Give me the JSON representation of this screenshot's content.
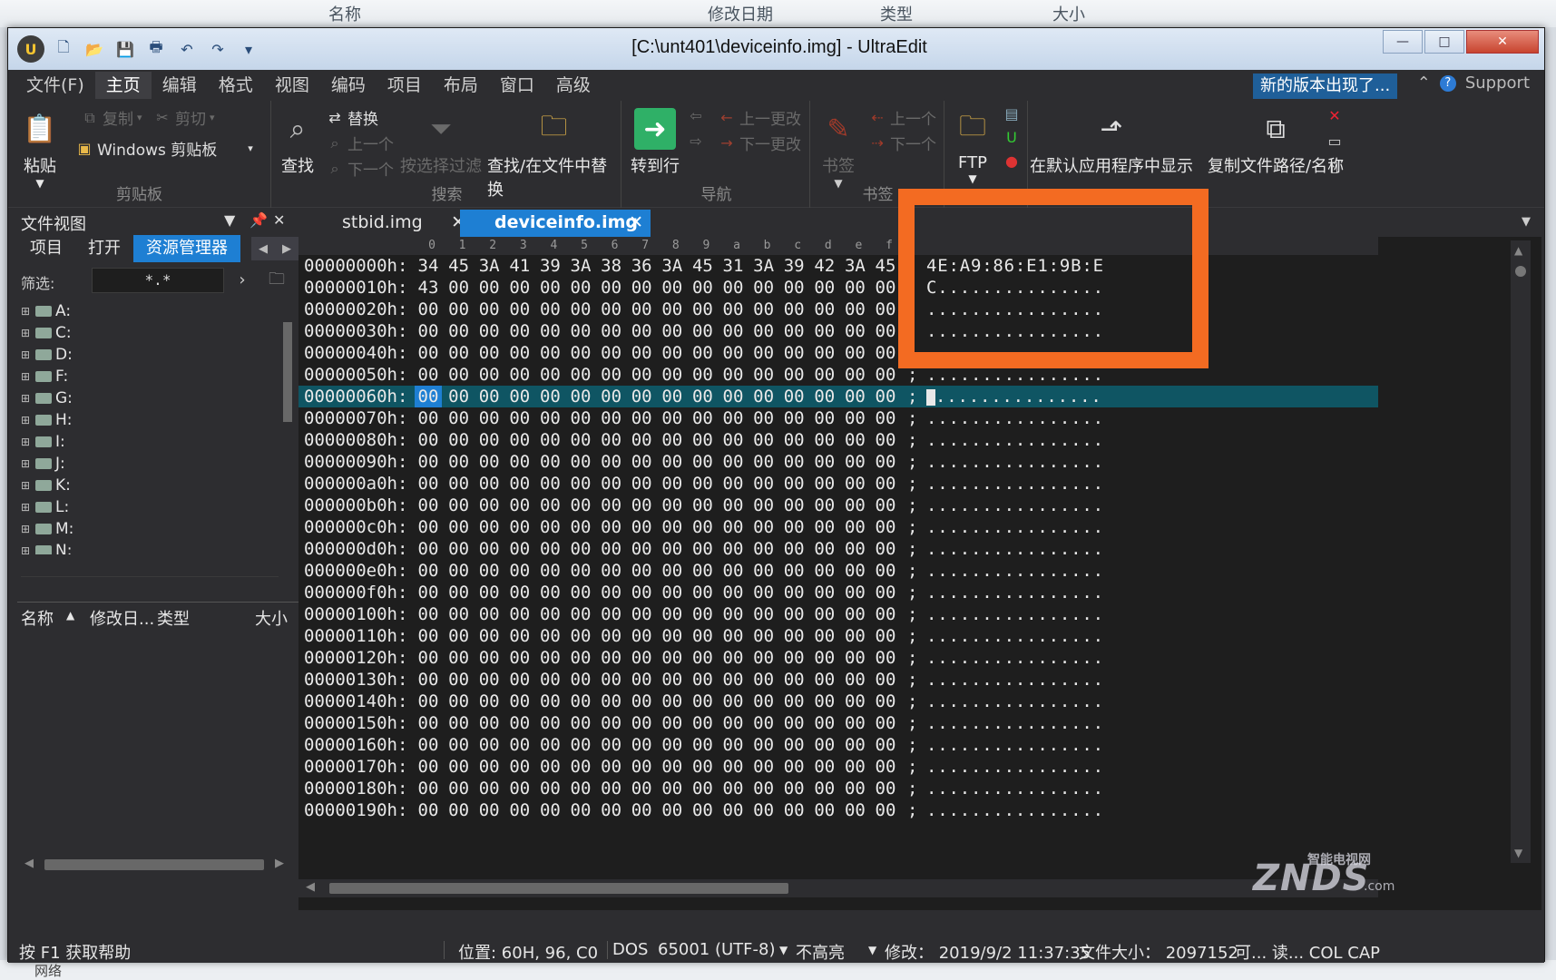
{
  "background_explorer": {
    "col_name": "名称",
    "col_modified": "修改日期",
    "col_type": "类型",
    "col_size": "大小",
    "bottom_text": "网络"
  },
  "window": {
    "title": "[C:\\unt401\\deviceinfo.img] - UltraEdit",
    "app_logo": "U",
    "controls": {
      "minimize": "—",
      "maximize": "□",
      "close": "✕"
    }
  },
  "menu": {
    "items": [
      "文件(F)",
      "主页",
      "编辑",
      "格式",
      "视图",
      "编码",
      "项目",
      "布局",
      "窗口",
      "高级"
    ],
    "active_index": 1,
    "notice": "新的版本出现了...",
    "support": "Support"
  },
  "ribbon": {
    "clipboard": {
      "paste": "粘贴",
      "copy": "复制",
      "cut": "剪切",
      "windows_clipboard": "Windows 剪贴板",
      "group": "剪贴板"
    },
    "search": {
      "find": "查找",
      "replace": "替换",
      "prev": "上一个",
      "next": "下一个",
      "filter": "按选择过滤",
      "find_in_files": "查找/在文件中替换",
      "group": "搜索"
    },
    "navigation": {
      "goto_line": "转到行",
      "prev_change": "上一更改",
      "next_change": "下一更改",
      "group": "导航"
    },
    "bookmarks": {
      "bookmark": "书签",
      "prev": "上一个",
      "next": "下一个",
      "group": "书签"
    },
    "ftp": {
      "label": "FTP"
    },
    "active_file": {
      "show_default": "在默认应用程序中显示",
      "copy_path": "复制文件路径/名称"
    }
  },
  "file_view": {
    "title": "文件视图",
    "tabs": [
      "项目",
      "打开",
      "资源管理器"
    ],
    "active_tab": 2,
    "filter_label": "筛选:",
    "filter_value": "*.*",
    "drives": [
      "A:",
      "C:",
      "D:",
      "F:",
      "G:",
      "H:",
      "I:",
      "J:",
      "K:",
      "L:",
      "M:",
      "N:"
    ],
    "columns": {
      "name": "名称",
      "modified": "修改日...",
      "type": "类型",
      "size": "大小"
    }
  },
  "editor": {
    "tabs": [
      {
        "label": "stbid.img",
        "close": "✕"
      },
      {
        "label": "deviceinfo.img",
        "close": "✕"
      }
    ],
    "active_tab": 1,
    "ruler": [
      "0",
      "1",
      "2",
      "3",
      "4",
      "5",
      "6",
      "7",
      "8",
      "9",
      "a",
      "b",
      "c",
      "d",
      "e",
      "f"
    ],
    "selected_row": 6,
    "rows": [
      {
        "addr": "00000000h:",
        "bytes": [
          "34",
          "45",
          "3A",
          "41",
          "39",
          "3A",
          "38",
          "36",
          "3A",
          "45",
          "31",
          "3A",
          "39",
          "42",
          "3A",
          "45"
        ],
        "sep": "",
        "ascii": "4E:A9:86:E1:9B:E"
      },
      {
        "addr": "00000010h:",
        "bytes": [
          "43",
          "00",
          "00",
          "00",
          "00",
          "00",
          "00",
          "00",
          "00",
          "00",
          "00",
          "00",
          "00",
          "00",
          "00",
          "00"
        ],
        "sep": "",
        "ascii": "C..............."
      },
      {
        "addr": "00000020h:",
        "bytes": [
          "00",
          "00",
          "00",
          "00",
          "00",
          "00",
          "00",
          "00",
          "00",
          "00",
          "00",
          "00",
          "00",
          "00",
          "00",
          "00"
        ],
        "sep": "",
        "ascii": "................"
      },
      {
        "addr": "00000030h:",
        "bytes": [
          "00",
          "00",
          "00",
          "00",
          "00",
          "00",
          "00",
          "00",
          "00",
          "00",
          "00",
          "00",
          "00",
          "00",
          "00",
          "00"
        ],
        "sep": "",
        "ascii": "................"
      },
      {
        "addr": "00000040h:",
        "bytes": [
          "00",
          "00",
          "00",
          "00",
          "00",
          "00",
          "00",
          "00",
          "00",
          "00",
          "00",
          "00",
          "00",
          "00",
          "00",
          "00"
        ],
        "sep": ";",
        "ascii": "................"
      },
      {
        "addr": "00000050h:",
        "bytes": [
          "00",
          "00",
          "00",
          "00",
          "00",
          "00",
          "00",
          "00",
          "00",
          "00",
          "00",
          "00",
          "00",
          "00",
          "00",
          "00"
        ],
        "sep": ";",
        "ascii": "................"
      },
      {
        "addr": "00000060h:",
        "bytes": [
          "00",
          "00",
          "00",
          "00",
          "00",
          "00",
          "00",
          "00",
          "00",
          "00",
          "00",
          "00",
          "00",
          "00",
          "00",
          "00"
        ],
        "sep": ";",
        "ascii": "...............",
        "caret": true
      },
      {
        "addr": "00000070h:",
        "bytes": [
          "00",
          "00",
          "00",
          "00",
          "00",
          "00",
          "00",
          "00",
          "00",
          "00",
          "00",
          "00",
          "00",
          "00",
          "00",
          "00"
        ],
        "sep": ";",
        "ascii": "................"
      },
      {
        "addr": "00000080h:",
        "bytes": [
          "00",
          "00",
          "00",
          "00",
          "00",
          "00",
          "00",
          "00",
          "00",
          "00",
          "00",
          "00",
          "00",
          "00",
          "00",
          "00"
        ],
        "sep": ";",
        "ascii": "................"
      },
      {
        "addr": "00000090h:",
        "bytes": [
          "00",
          "00",
          "00",
          "00",
          "00",
          "00",
          "00",
          "00",
          "00",
          "00",
          "00",
          "00",
          "00",
          "00",
          "00",
          "00"
        ],
        "sep": ";",
        "ascii": "................"
      },
      {
        "addr": "000000a0h:",
        "bytes": [
          "00",
          "00",
          "00",
          "00",
          "00",
          "00",
          "00",
          "00",
          "00",
          "00",
          "00",
          "00",
          "00",
          "00",
          "00",
          "00"
        ],
        "sep": ";",
        "ascii": "................"
      },
      {
        "addr": "000000b0h:",
        "bytes": [
          "00",
          "00",
          "00",
          "00",
          "00",
          "00",
          "00",
          "00",
          "00",
          "00",
          "00",
          "00",
          "00",
          "00",
          "00",
          "00"
        ],
        "sep": ";",
        "ascii": "................"
      },
      {
        "addr": "000000c0h:",
        "bytes": [
          "00",
          "00",
          "00",
          "00",
          "00",
          "00",
          "00",
          "00",
          "00",
          "00",
          "00",
          "00",
          "00",
          "00",
          "00",
          "00"
        ],
        "sep": ";",
        "ascii": "................"
      },
      {
        "addr": "000000d0h:",
        "bytes": [
          "00",
          "00",
          "00",
          "00",
          "00",
          "00",
          "00",
          "00",
          "00",
          "00",
          "00",
          "00",
          "00",
          "00",
          "00",
          "00"
        ],
        "sep": ";",
        "ascii": "................"
      },
      {
        "addr": "000000e0h:",
        "bytes": [
          "00",
          "00",
          "00",
          "00",
          "00",
          "00",
          "00",
          "00",
          "00",
          "00",
          "00",
          "00",
          "00",
          "00",
          "00",
          "00"
        ],
        "sep": ";",
        "ascii": "................"
      },
      {
        "addr": "000000f0h:",
        "bytes": [
          "00",
          "00",
          "00",
          "00",
          "00",
          "00",
          "00",
          "00",
          "00",
          "00",
          "00",
          "00",
          "00",
          "00",
          "00",
          "00"
        ],
        "sep": ";",
        "ascii": "................"
      },
      {
        "addr": "00000100h:",
        "bytes": [
          "00",
          "00",
          "00",
          "00",
          "00",
          "00",
          "00",
          "00",
          "00",
          "00",
          "00",
          "00",
          "00",
          "00",
          "00",
          "00"
        ],
        "sep": ";",
        "ascii": "................"
      },
      {
        "addr": "00000110h:",
        "bytes": [
          "00",
          "00",
          "00",
          "00",
          "00",
          "00",
          "00",
          "00",
          "00",
          "00",
          "00",
          "00",
          "00",
          "00",
          "00",
          "00"
        ],
        "sep": ";",
        "ascii": "................"
      },
      {
        "addr": "00000120h:",
        "bytes": [
          "00",
          "00",
          "00",
          "00",
          "00",
          "00",
          "00",
          "00",
          "00",
          "00",
          "00",
          "00",
          "00",
          "00",
          "00",
          "00"
        ],
        "sep": ";",
        "ascii": "................"
      },
      {
        "addr": "00000130h:",
        "bytes": [
          "00",
          "00",
          "00",
          "00",
          "00",
          "00",
          "00",
          "00",
          "00",
          "00",
          "00",
          "00",
          "00",
          "00",
          "00",
          "00"
        ],
        "sep": ";",
        "ascii": "................"
      },
      {
        "addr": "00000140h:",
        "bytes": [
          "00",
          "00",
          "00",
          "00",
          "00",
          "00",
          "00",
          "00",
          "00",
          "00",
          "00",
          "00",
          "00",
          "00",
          "00",
          "00"
        ],
        "sep": ";",
        "ascii": "................"
      },
      {
        "addr": "00000150h:",
        "bytes": [
          "00",
          "00",
          "00",
          "00",
          "00",
          "00",
          "00",
          "00",
          "00",
          "00",
          "00",
          "00",
          "00",
          "00",
          "00",
          "00"
        ],
        "sep": ";",
        "ascii": "................"
      },
      {
        "addr": "00000160h:",
        "bytes": [
          "00",
          "00",
          "00",
          "00",
          "00",
          "00",
          "00",
          "00",
          "00",
          "00",
          "00",
          "00",
          "00",
          "00",
          "00",
          "00"
        ],
        "sep": ";",
        "ascii": "................"
      },
      {
        "addr": "00000170h:",
        "bytes": [
          "00",
          "00",
          "00",
          "00",
          "00",
          "00",
          "00",
          "00",
          "00",
          "00",
          "00",
          "00",
          "00",
          "00",
          "00",
          "00"
        ],
        "sep": ";",
        "ascii": "................"
      },
      {
        "addr": "00000180h:",
        "bytes": [
          "00",
          "00",
          "00",
          "00",
          "00",
          "00",
          "00",
          "00",
          "00",
          "00",
          "00",
          "00",
          "00",
          "00",
          "00",
          "00"
        ],
        "sep": ";",
        "ascii": "................"
      },
      {
        "addr": "00000190h:",
        "bytes": [
          "00",
          "00",
          "00",
          "00",
          "00",
          "00",
          "00",
          "00",
          "00",
          "00",
          "00",
          "00",
          "00",
          "00",
          "00",
          "00"
        ],
        "sep": ";",
        "ascii": "................"
      }
    ]
  },
  "statusbar": {
    "help": "按 F1 获取帮助",
    "position": "位置: 60H, 96, C0",
    "line_ending": "DOS",
    "encoding": "65001 (UTF-8)",
    "highlight": "不高亮",
    "modified": "修改： 2019/9/2 11:37:35",
    "filesize": "文件大小： 2097152",
    "extra": "可... 读... COL CAP"
  },
  "watermark": {
    "brand": "ZNDS",
    "sub": "智能电视网",
    "suffix": ".com"
  },
  "colors": {
    "accent": "#1e7fd3",
    "highlight_box": "#f36b22",
    "selected_row": "#0f5563"
  }
}
